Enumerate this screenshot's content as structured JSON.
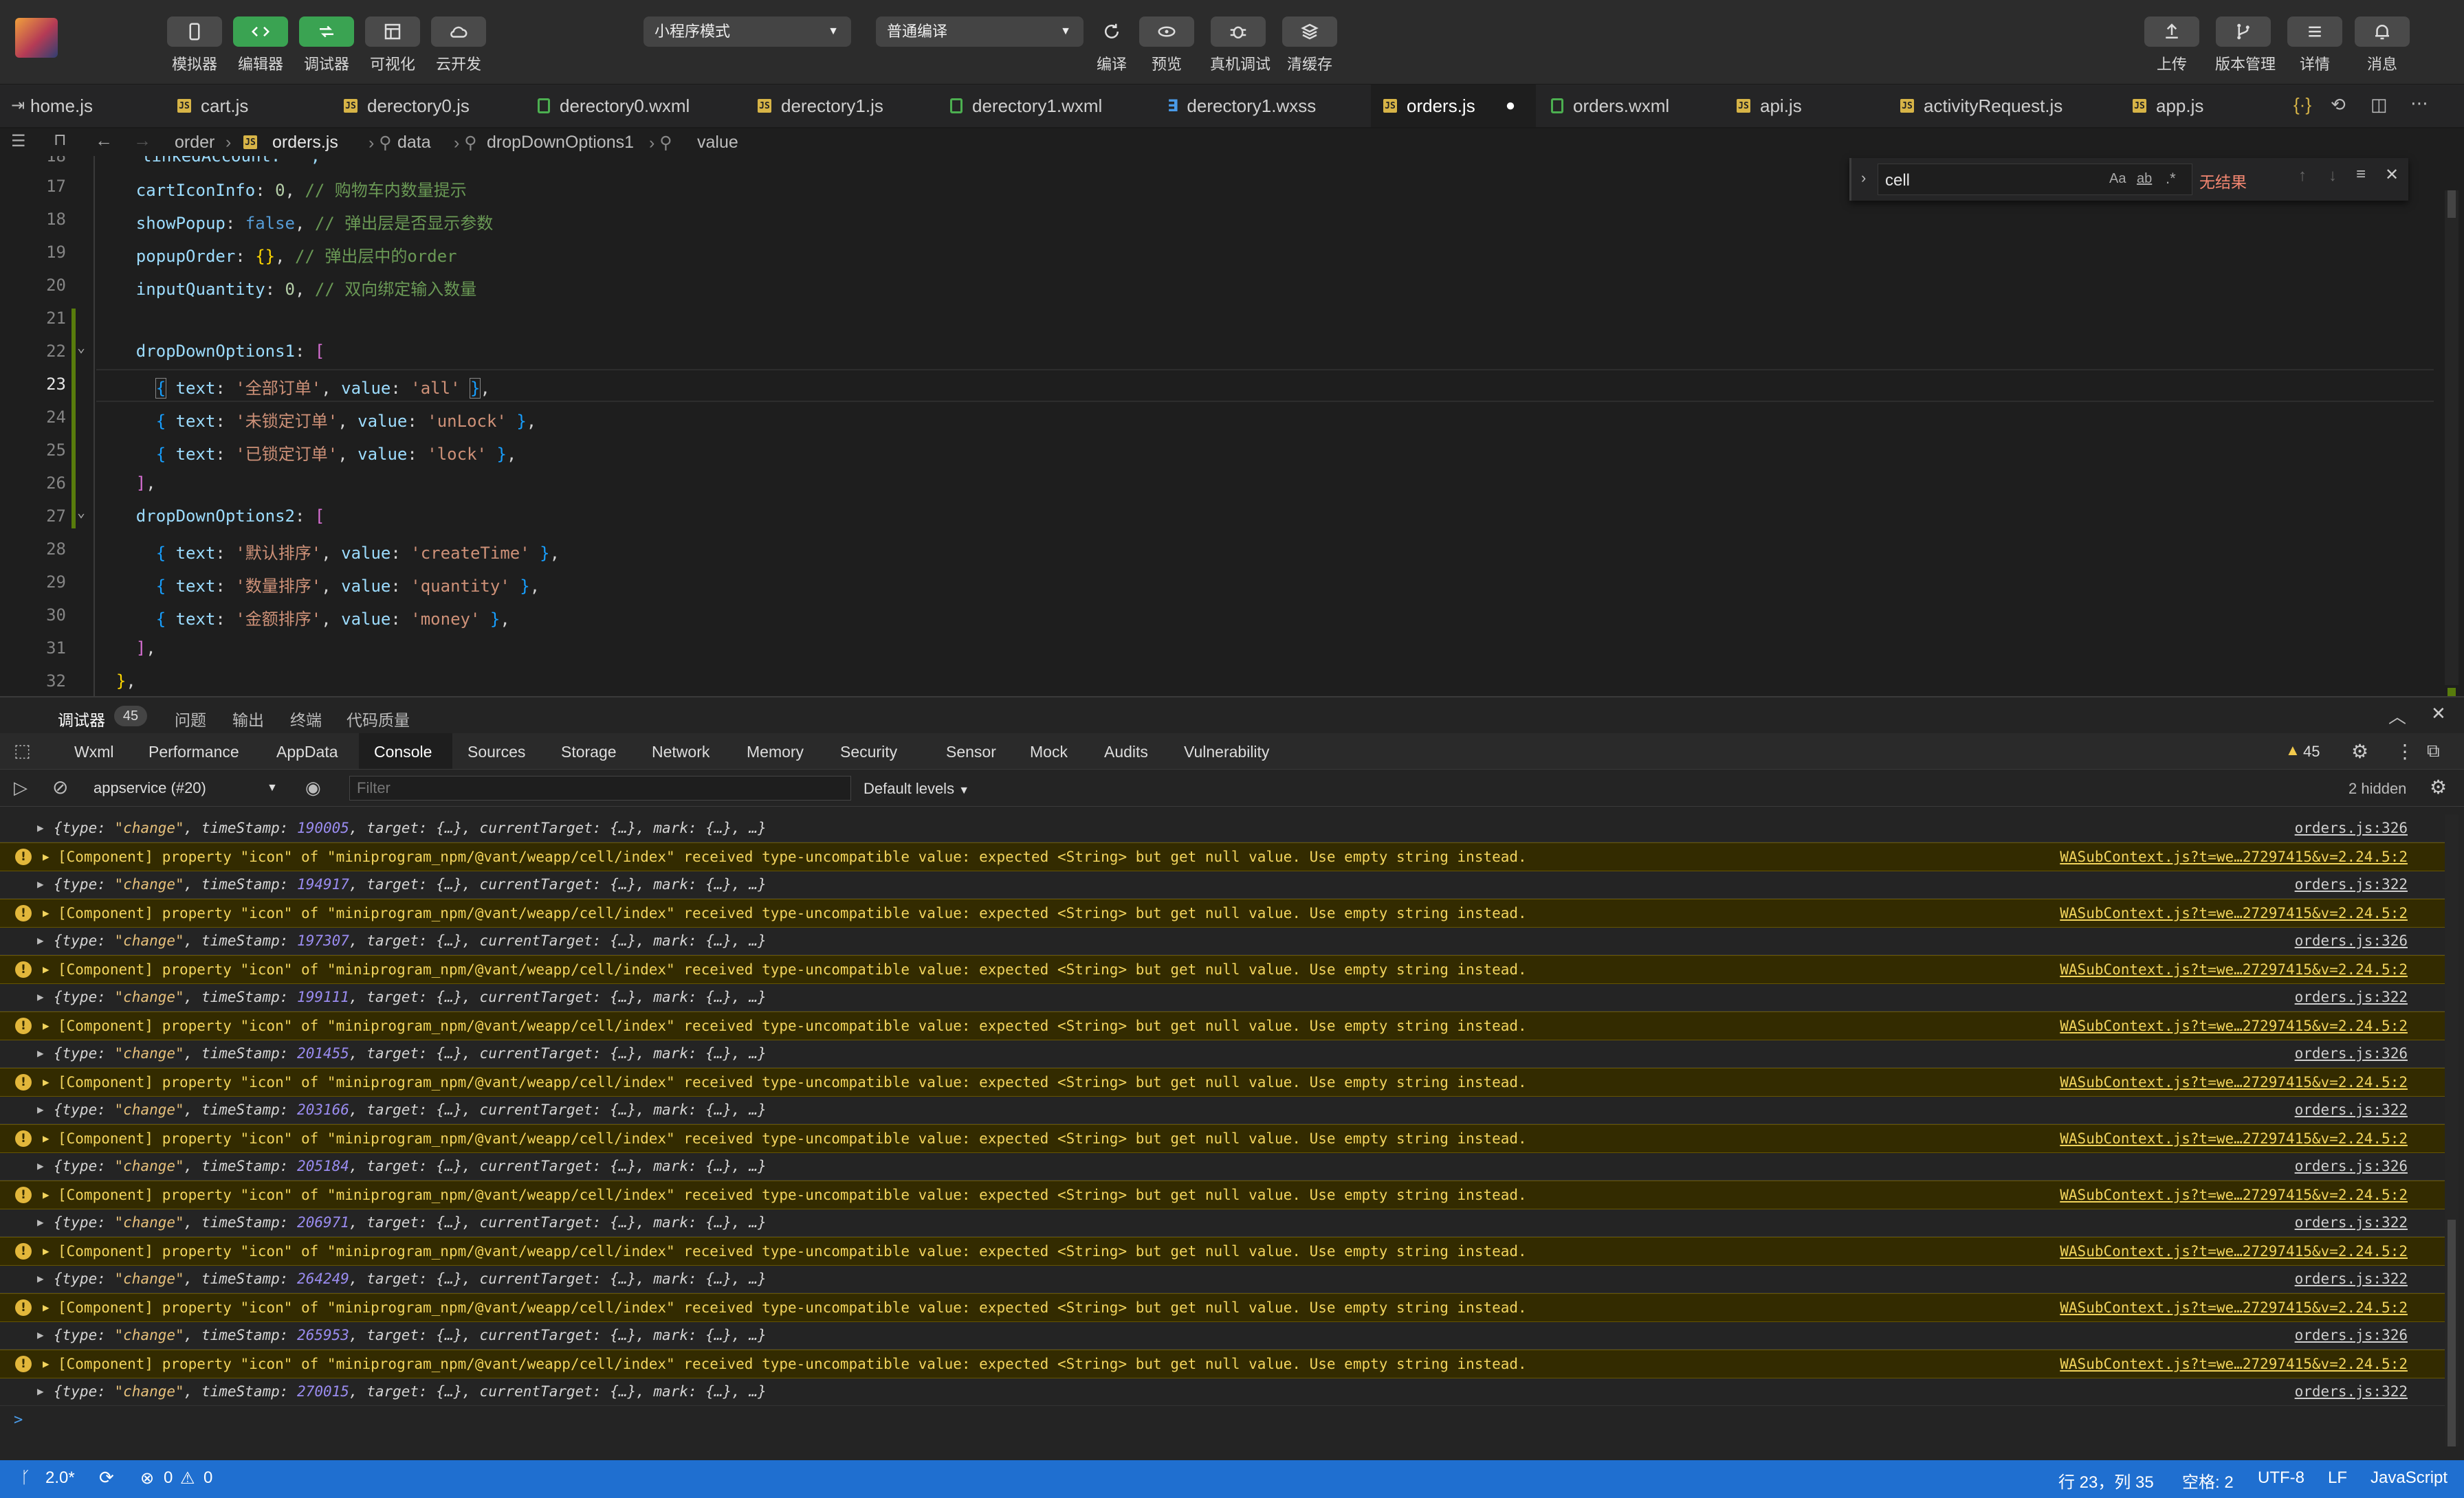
{
  "toolbar": {
    "left_buttons": [
      {
        "label": "模拟器",
        "icon": "phone-icon"
      },
      {
        "label": "编辑器",
        "icon": "code-icon"
      },
      {
        "label": "调试器",
        "icon": "debug-icon"
      },
      {
        "label": "可视化",
        "icon": "layout-icon"
      },
      {
        "label": "云开发",
        "icon": "cloud-icon"
      }
    ],
    "mode_select": "小程序模式",
    "compile_select": "普通编译",
    "mid_buttons": [
      {
        "label": "编译",
        "icon": "refresh-icon"
      },
      {
        "label": "预览",
        "icon": "eye-icon"
      },
      {
        "label": "真机调试",
        "icon": "bug-icon"
      },
      {
        "label": "清缓存",
        "icon": "layers-icon"
      }
    ],
    "right_buttons": [
      {
        "label": "上传",
        "icon": "upload-icon"
      },
      {
        "label": "版本管理",
        "icon": "branch-icon"
      },
      {
        "label": "详情",
        "icon": "menu-icon"
      },
      {
        "label": "消息",
        "icon": "bell-icon"
      }
    ]
  },
  "tabs": [
    {
      "label": "home.js",
      "type": "js"
    },
    {
      "label": "cart.js",
      "type": "js"
    },
    {
      "label": "derectory0.js",
      "type": "js"
    },
    {
      "label": "derectory0.wxml",
      "type": "wxml"
    },
    {
      "label": "derectory1.js",
      "type": "js"
    },
    {
      "label": "derectory1.wxml",
      "type": "wxml"
    },
    {
      "label": "derectory1.wxss",
      "type": "css"
    },
    {
      "label": "orders.js",
      "type": "js",
      "active": true
    },
    {
      "label": "orders.wxml",
      "type": "wxml"
    },
    {
      "label": "api.js",
      "type": "js"
    },
    {
      "label": "activityRequest.js",
      "type": "js"
    },
    {
      "label": "app.js",
      "type": "js"
    }
  ],
  "breadcrumb": [
    "order",
    "orders.js",
    "data",
    "dropDownOptions1",
    "value"
  ],
  "editor": {
    "top_partial_line": "18",
    "top_partial_text": "linkedAccount: '',"
  },
  "find": {
    "query": "cell",
    "case_label": "Aa",
    "word_label": "ab",
    "regex_label": ".*",
    "result": "无结果"
  },
  "devtools": {
    "panel_tabs": [
      "调试器",
      "问题",
      "输出",
      "终端",
      "代码质量"
    ],
    "panel_badge": "45",
    "tool_tabs": [
      "Wxml",
      "Performance",
      "AppData",
      "Console",
      "Sources",
      "Storage",
      "Network",
      "Memory",
      "Security",
      "Sensor",
      "Mock",
      "Audits",
      "Vulnerability"
    ],
    "warn_count": "45",
    "context": "appservice (#20)",
    "filter_placeholder": "Filter",
    "levels": "Default levels",
    "hidden": "2 hidden",
    "warning_text": "[Component] property \"icon\" of \"miniprogram_npm/@vant/weapp/cell/index\" received type-uncompatible value: expected <String> but get null value. Use empty string instead.",
    "warning_source": "WASubContext.js?t=we…27297415&v=2.24.5:2",
    "object_prefix": "{type: ",
    "object_type": "\"change\"",
    "object_ts_label": ", timeStamp: ",
    "object_suffix": ", target: {…}, currentTarget: {…}, mark: {…}, …}",
    "rows": [
      {
        "kind": "obj",
        "ts": "190005",
        "src": "orders.js:326"
      },
      {
        "kind": "warn"
      },
      {
        "kind": "obj",
        "ts": "194917",
        "src": "orders.js:322"
      },
      {
        "kind": "warn"
      },
      {
        "kind": "obj",
        "ts": "197307",
        "src": "orders.js:326"
      },
      {
        "kind": "warn"
      },
      {
        "kind": "obj",
        "ts": "199111",
        "src": "orders.js:322"
      },
      {
        "kind": "warn"
      },
      {
        "kind": "obj",
        "ts": "201455",
        "src": "orders.js:326"
      },
      {
        "kind": "warn"
      },
      {
        "kind": "obj",
        "ts": "203166",
        "src": "orders.js:322"
      },
      {
        "kind": "warn"
      },
      {
        "kind": "obj",
        "ts": "205184",
        "src": "orders.js:326"
      },
      {
        "kind": "warn"
      },
      {
        "kind": "obj",
        "ts": "206971",
        "src": "orders.js:322"
      },
      {
        "kind": "warn"
      },
      {
        "kind": "obj",
        "ts": "264249",
        "src": "orders.js:322"
      },
      {
        "kind": "warn"
      },
      {
        "kind": "obj",
        "ts": "265953",
        "src": "orders.js:326"
      },
      {
        "kind": "warn"
      },
      {
        "kind": "obj",
        "ts": "270015",
        "src": "orders.js:322"
      }
    ],
    "prompt": ">"
  },
  "status": {
    "branch": "2.0*",
    "errors": "0",
    "warnings": "0",
    "position": "行 23，列 35",
    "spaces": "空格: 2",
    "encoding": "UTF-8",
    "eol": "LF",
    "language": "JavaScript"
  },
  "colors": {
    "toolbar_bg": "#2c2c2c",
    "editor_bg": "#1e1e1e",
    "status_bg": "#1f6fd0",
    "warning_bg": "#332b00",
    "active_green": "#3aa352"
  }
}
